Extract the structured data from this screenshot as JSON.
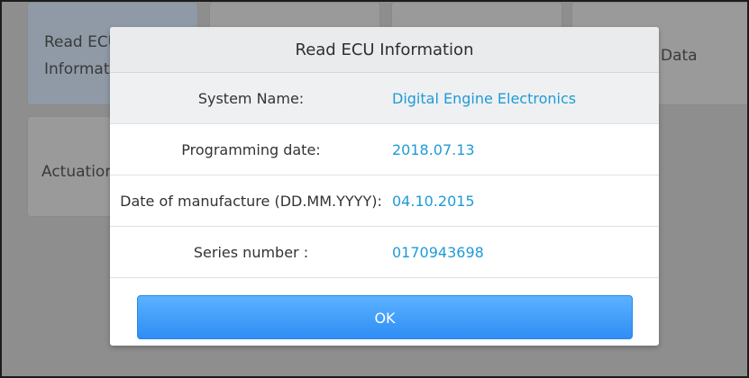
{
  "background_tiles": {
    "t1": "Read ECU Information",
    "t4": "Data",
    "t5": "Actuation"
  },
  "dialog": {
    "title": "Read ECU Information",
    "rows": [
      {
        "label": "System Name:",
        "value": "Digital Engine Electronics"
      },
      {
        "label": "Programming date:",
        "value": "2018.07.13"
      },
      {
        "label": "Date of manufacture (DD.MM.YYYY):",
        "value": "04.10.2015"
      },
      {
        "label": "Series number :",
        "value": "0170943698"
      }
    ],
    "ok_label": "OK"
  },
  "colors": {
    "value_text": "#1f9bd6",
    "ok_button": "#3a95f7",
    "overlay": "#8e8e8e"
  }
}
